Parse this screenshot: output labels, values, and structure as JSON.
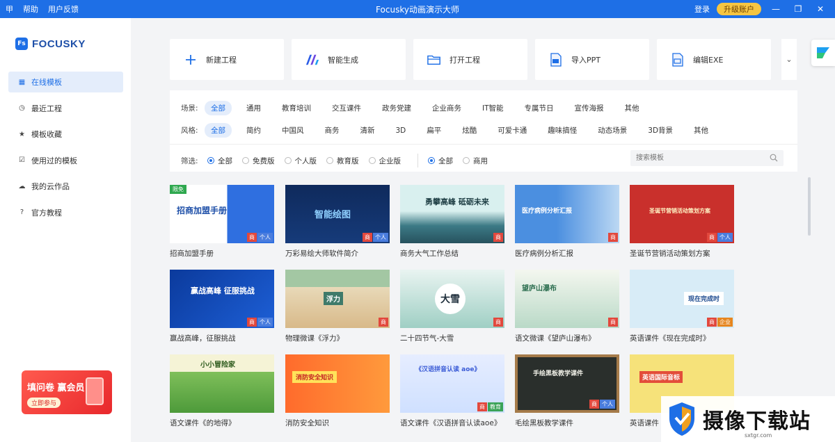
{
  "titlebar": {
    "menu_icon": "甲",
    "help": "帮助",
    "feedback": "用户反馈",
    "title": "Focusky动画演示大师",
    "login": "登录",
    "upgrade": "升级账户"
  },
  "brand": {
    "badge": "Fs",
    "name": "FOCUSKY"
  },
  "sidebar": {
    "items": [
      {
        "label": "在线模板",
        "icon": "grid-icon"
      },
      {
        "label": "最近工程",
        "icon": "clock-icon"
      },
      {
        "label": "模板收藏",
        "icon": "star-icon"
      },
      {
        "label": "使用过的模板",
        "icon": "checkbox-icon"
      },
      {
        "label": "我的云作品",
        "icon": "cloud-icon"
      },
      {
        "label": "官方教程",
        "icon": "help-icon"
      }
    ]
  },
  "promo": {
    "title": "填问卷 赢会员",
    "cta": "立即参与"
  },
  "actions": [
    {
      "label": "新建工程",
      "icon": "plus-icon"
    },
    {
      "label": "智能生成",
      "icon": "ai-icon"
    },
    {
      "label": "打开工程",
      "icon": "folder-icon"
    },
    {
      "label": "导入PPT",
      "icon": "ppt-icon"
    },
    {
      "label": "编辑EXE",
      "icon": "exe-icon"
    }
  ],
  "filters": {
    "scene_label": "场景:",
    "scenes": [
      "全部",
      "通用",
      "教育培训",
      "交互课件",
      "政务党建",
      "企业商务",
      "IT智能",
      "专属节日",
      "宣传海报",
      "其他"
    ],
    "style_label": "风格:",
    "styles": [
      "全部",
      "简约",
      "中国风",
      "商务",
      "清新",
      "3D",
      "扁平",
      "炫酷",
      "可爱卡通",
      "趣味搞怪",
      "动态场景",
      "3D背景",
      "其他"
    ],
    "screen_label": "筛选:",
    "editions": [
      "全部",
      "免费版",
      "个人版",
      "教育版",
      "企业版"
    ],
    "usage": [
      "全部",
      "商用"
    ],
    "search_placeholder": "搜索模板"
  },
  "templates": [
    {
      "caption": "招商加盟手册",
      "thumb_text": "招商加盟手册",
      "free": "限免",
      "badges": [
        "商",
        "个人"
      ]
    },
    {
      "caption": "万彩易绘大师软件简介",
      "thumb_text": "智能绘图",
      "badges": [
        "商",
        "个人"
      ]
    },
    {
      "caption": "商务大气工作总结",
      "thumb_text": "勇攀高峰 砥砺未来",
      "badges": [
        "商"
      ]
    },
    {
      "caption": "医疗病例分析汇报",
      "thumb_text": "医疗病例分析汇报",
      "badges": [
        "商"
      ]
    },
    {
      "caption": "圣诞节营销活动策划方案",
      "thumb_text": "圣诞节营销活动策划方案",
      "badges": [
        "商",
        "个人"
      ]
    },
    {
      "caption": "赢战高峰，征服挑战",
      "thumb_text": "赢战高峰 征服挑战",
      "badges": [
        "商",
        "个人"
      ]
    },
    {
      "caption": "物理微课《浮力》",
      "thumb_text": "浮力",
      "badges": [
        "商"
      ]
    },
    {
      "caption": "二十四节气-大雪",
      "thumb_text": "大雪",
      "badges": [
        "商"
      ]
    },
    {
      "caption": "语文微课《望庐山瀑布》",
      "thumb_text": "望庐山瀑布",
      "badges": [
        "商"
      ]
    },
    {
      "caption": "英语课件《现在完成时》",
      "thumb_text": "现在完成时",
      "badges": [
        "商",
        "企业"
      ]
    },
    {
      "caption": "语文课件《的地得》",
      "thumb_text": "小小冒险家",
      "badges": []
    },
    {
      "caption": "消防安全知识",
      "thumb_text": "消防安全知识",
      "badges": []
    },
    {
      "caption": "语文课件《汉语拼音认读aoe》",
      "thumb_text": "《汉语拼音认读 aoe》",
      "badges": [
        "商",
        "教育"
      ]
    },
    {
      "caption": "毛绘黑板教学课件",
      "thumb_text": "手绘黑板教学课件",
      "badges": [
        "商",
        "个人"
      ]
    },
    {
      "caption": "英语课件",
      "thumb_text": "英语国际音标",
      "badges": []
    }
  ],
  "watermark": {
    "text": "摄像下载站",
    "url": "sxtgr.com"
  },
  "colors": {
    "accent": "#1e6fe6",
    "titlebar": "#1e6fe6",
    "upgrade": "#f5c542",
    "badge_shang": "#e2483d",
    "badge_geren": "#4a7dde"
  }
}
